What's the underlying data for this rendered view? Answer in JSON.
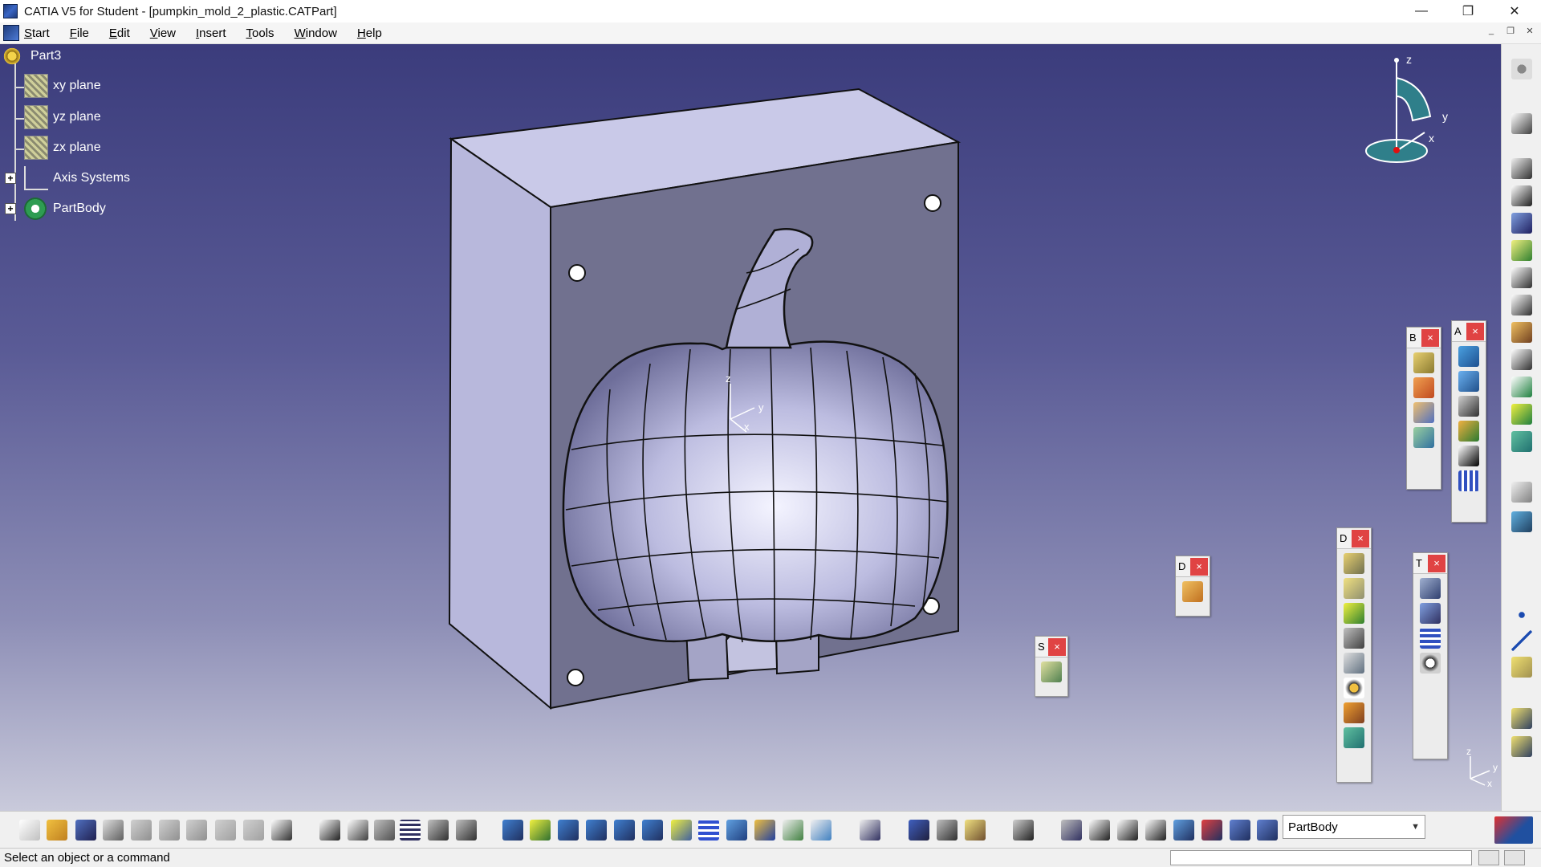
{
  "window": {
    "title": "CATIA V5 for Student - [pumpkin_mold_2_plastic.CATPart]",
    "minimize_glyph": "—",
    "restore_glyph": "❐",
    "close_glyph": "✕"
  },
  "menu": {
    "items": [
      "Start",
      "File",
      "Edit",
      "View",
      "Insert",
      "Tools",
      "Window",
      "Help"
    ],
    "mdi_min": "_",
    "mdi_restore": "❐",
    "mdi_close": "✕"
  },
  "tree": {
    "root": "Part3",
    "items": [
      "xy plane",
      "yz plane",
      "zx plane",
      "Axis Systems",
      "PartBody"
    ]
  },
  "compass": {
    "x": "x",
    "y": "y",
    "z": "z"
  },
  "model_axes": {
    "x": "x",
    "y": "y",
    "z": "z"
  },
  "floating_toolbars": {
    "b": {
      "label": "B",
      "close": "×"
    },
    "a": {
      "label": "A",
      "close": "×"
    },
    "d1": {
      "label": "D",
      "close": "×"
    },
    "d2": {
      "label": "D",
      "close": "×"
    },
    "s": {
      "label": "S",
      "close": "×"
    },
    "t": {
      "label": "T",
      "close": "×"
    }
  },
  "workbench_select": {
    "value": "PartBody"
  },
  "status": {
    "message": "Select an object or a command"
  },
  "colors": {
    "viewport_top": "#3b3c7c",
    "viewport_bottom": "#c9cadb",
    "close_red": "#e04343",
    "mold_face": "#71718f"
  }
}
